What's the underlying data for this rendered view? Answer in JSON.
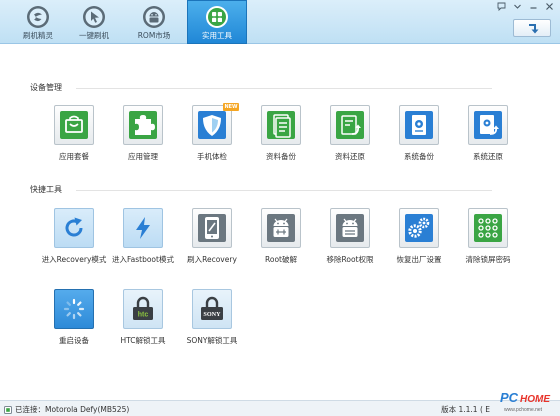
{
  "header": {
    "tabs": [
      {
        "label": "刷机精灵",
        "icon": "shuaji-logo-icon",
        "active": false
      },
      {
        "label": "一键刷机",
        "icon": "one-click-flash-icon",
        "active": false
      },
      {
        "label": "ROM市场",
        "icon": "rom-market-icon",
        "active": false
      },
      {
        "label": "实用工具",
        "icon": "utility-tools-icon",
        "active": true
      }
    ],
    "window_controls": [
      "help-icon",
      "menu-icon",
      "minimize-icon",
      "close-icon"
    ]
  },
  "sections": {
    "device": {
      "title": "设备管理",
      "items": [
        {
          "label": "应用套餐",
          "icon": "app-bundle-icon",
          "color": "#3aa544"
        },
        {
          "label": "应用管理",
          "icon": "puzzle-icon",
          "color": "#3aa544"
        },
        {
          "label": "手机体检",
          "icon": "shield-icon",
          "color": "#2a7fd4",
          "badge": "NEW"
        },
        {
          "label": "资料备份",
          "icon": "document-backup-icon",
          "color": "#3aa544"
        },
        {
          "label": "资料还原",
          "icon": "document-restore-icon",
          "color": "#3aa544"
        },
        {
          "label": "系统备份",
          "icon": "system-backup-icon",
          "color": "#2a7fd4"
        },
        {
          "label": "系统还原",
          "icon": "system-restore-icon",
          "color": "#2a7fd4"
        }
      ]
    },
    "quick": {
      "title": "快捷工具",
      "items": [
        {
          "label": "进入Recovery模式",
          "icon": "refresh-icon"
        },
        {
          "label": "进入Fastboot模式",
          "icon": "lightning-icon"
        },
        {
          "label": "刷入Recovery",
          "icon": "phone-flash-icon"
        },
        {
          "label": "Root破解",
          "icon": "android-unlock-icon"
        },
        {
          "label": "移除Root权限",
          "icon": "android-lock-icon"
        },
        {
          "label": "恢复出厂设置",
          "icon": "gears-icon"
        },
        {
          "label": "清除锁屏密码",
          "icon": "pattern-lock-icon"
        },
        {
          "label": "重启设备",
          "icon": "spinner-icon"
        },
        {
          "label": "HTC解锁工具",
          "icon": "htc-unlock-icon",
          "brand": "htc"
        },
        {
          "label": "SONY解锁工具",
          "icon": "sony-unlock-icon",
          "brand": "SONY"
        }
      ]
    }
  },
  "status": {
    "connection": "已连接：Motorola Defy(MB525)",
    "version": "版本 1.1.1 ( E"
  },
  "watermark": {
    "line1": "PC",
    "line2": "HOME",
    "line3": "www.pchome.net"
  },
  "colors": {
    "accent": "#1f86d6",
    "green": "#3aa544",
    "blue": "#2a7fd4",
    "tile_blue": "#3f9be0"
  }
}
